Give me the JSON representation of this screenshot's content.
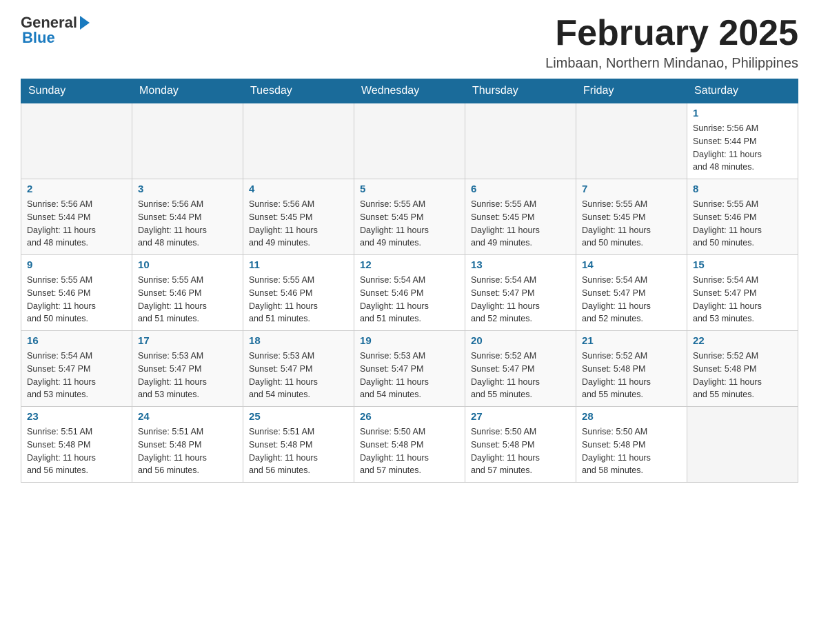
{
  "logo": {
    "general": "General",
    "blue": "Blue"
  },
  "header": {
    "title": "February 2025",
    "location": "Limbaan, Northern Mindanao, Philippines"
  },
  "weekdays": [
    "Sunday",
    "Monday",
    "Tuesday",
    "Wednesday",
    "Thursday",
    "Friday",
    "Saturday"
  ],
  "weeks": [
    [
      {
        "day": "",
        "info": ""
      },
      {
        "day": "",
        "info": ""
      },
      {
        "day": "",
        "info": ""
      },
      {
        "day": "",
        "info": ""
      },
      {
        "day": "",
        "info": ""
      },
      {
        "day": "",
        "info": ""
      },
      {
        "day": "1",
        "info": "Sunrise: 5:56 AM\nSunset: 5:44 PM\nDaylight: 11 hours\nand 48 minutes."
      }
    ],
    [
      {
        "day": "2",
        "info": "Sunrise: 5:56 AM\nSunset: 5:44 PM\nDaylight: 11 hours\nand 48 minutes."
      },
      {
        "day": "3",
        "info": "Sunrise: 5:56 AM\nSunset: 5:44 PM\nDaylight: 11 hours\nand 48 minutes."
      },
      {
        "day": "4",
        "info": "Sunrise: 5:56 AM\nSunset: 5:45 PM\nDaylight: 11 hours\nand 49 minutes."
      },
      {
        "day": "5",
        "info": "Sunrise: 5:55 AM\nSunset: 5:45 PM\nDaylight: 11 hours\nand 49 minutes."
      },
      {
        "day": "6",
        "info": "Sunrise: 5:55 AM\nSunset: 5:45 PM\nDaylight: 11 hours\nand 49 minutes."
      },
      {
        "day": "7",
        "info": "Sunrise: 5:55 AM\nSunset: 5:45 PM\nDaylight: 11 hours\nand 50 minutes."
      },
      {
        "day": "8",
        "info": "Sunrise: 5:55 AM\nSunset: 5:46 PM\nDaylight: 11 hours\nand 50 minutes."
      }
    ],
    [
      {
        "day": "9",
        "info": "Sunrise: 5:55 AM\nSunset: 5:46 PM\nDaylight: 11 hours\nand 50 minutes."
      },
      {
        "day": "10",
        "info": "Sunrise: 5:55 AM\nSunset: 5:46 PM\nDaylight: 11 hours\nand 51 minutes."
      },
      {
        "day": "11",
        "info": "Sunrise: 5:55 AM\nSunset: 5:46 PM\nDaylight: 11 hours\nand 51 minutes."
      },
      {
        "day": "12",
        "info": "Sunrise: 5:54 AM\nSunset: 5:46 PM\nDaylight: 11 hours\nand 51 minutes."
      },
      {
        "day": "13",
        "info": "Sunrise: 5:54 AM\nSunset: 5:47 PM\nDaylight: 11 hours\nand 52 minutes."
      },
      {
        "day": "14",
        "info": "Sunrise: 5:54 AM\nSunset: 5:47 PM\nDaylight: 11 hours\nand 52 minutes."
      },
      {
        "day": "15",
        "info": "Sunrise: 5:54 AM\nSunset: 5:47 PM\nDaylight: 11 hours\nand 53 minutes."
      }
    ],
    [
      {
        "day": "16",
        "info": "Sunrise: 5:54 AM\nSunset: 5:47 PM\nDaylight: 11 hours\nand 53 minutes."
      },
      {
        "day": "17",
        "info": "Sunrise: 5:53 AM\nSunset: 5:47 PM\nDaylight: 11 hours\nand 53 minutes."
      },
      {
        "day": "18",
        "info": "Sunrise: 5:53 AM\nSunset: 5:47 PM\nDaylight: 11 hours\nand 54 minutes."
      },
      {
        "day": "19",
        "info": "Sunrise: 5:53 AM\nSunset: 5:47 PM\nDaylight: 11 hours\nand 54 minutes."
      },
      {
        "day": "20",
        "info": "Sunrise: 5:52 AM\nSunset: 5:47 PM\nDaylight: 11 hours\nand 55 minutes."
      },
      {
        "day": "21",
        "info": "Sunrise: 5:52 AM\nSunset: 5:48 PM\nDaylight: 11 hours\nand 55 minutes."
      },
      {
        "day": "22",
        "info": "Sunrise: 5:52 AM\nSunset: 5:48 PM\nDaylight: 11 hours\nand 55 minutes."
      }
    ],
    [
      {
        "day": "23",
        "info": "Sunrise: 5:51 AM\nSunset: 5:48 PM\nDaylight: 11 hours\nand 56 minutes."
      },
      {
        "day": "24",
        "info": "Sunrise: 5:51 AM\nSunset: 5:48 PM\nDaylight: 11 hours\nand 56 minutes."
      },
      {
        "day": "25",
        "info": "Sunrise: 5:51 AM\nSunset: 5:48 PM\nDaylight: 11 hours\nand 56 minutes."
      },
      {
        "day": "26",
        "info": "Sunrise: 5:50 AM\nSunset: 5:48 PM\nDaylight: 11 hours\nand 57 minutes."
      },
      {
        "day": "27",
        "info": "Sunrise: 5:50 AM\nSunset: 5:48 PM\nDaylight: 11 hours\nand 57 minutes."
      },
      {
        "day": "28",
        "info": "Sunrise: 5:50 AM\nSunset: 5:48 PM\nDaylight: 11 hours\nand 58 minutes."
      },
      {
        "day": "",
        "info": ""
      }
    ]
  ]
}
